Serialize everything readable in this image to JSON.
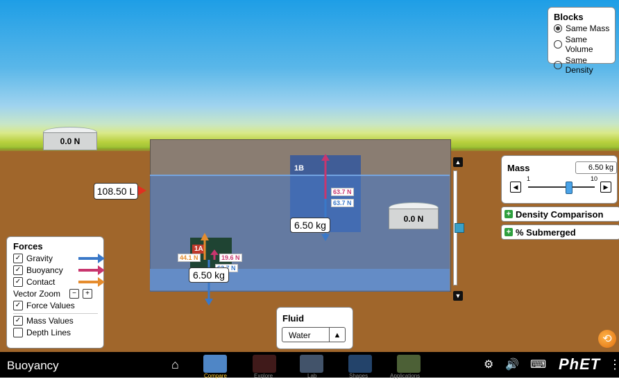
{
  "app": {
    "title": "Buoyancy"
  },
  "scene": {
    "left_scale_reading": "0.0 N",
    "right_scale_reading": "0.0 N",
    "volume_label": "108.50 L"
  },
  "blocks_panel": {
    "title": "Blocks",
    "options": [
      "Same Mass",
      "Same Volume",
      "Same Density"
    ],
    "selected": "Same Mass"
  },
  "block_b": {
    "label": "1B",
    "mass_value": "6.50 kg",
    "buoyancy_value": "63.7 N",
    "gravity_value": "63.7 N"
  },
  "block_a": {
    "label": "1A",
    "mass_value": "6.50 kg",
    "contact_value": "44.1 N",
    "buoyancy_value": "19.6 N",
    "gravity_value": "63.7 N"
  },
  "mass_panel": {
    "title": "Mass",
    "value": "6.50 kg",
    "slider_min": "1",
    "slider_max": "10",
    "slider_fraction": 0.61
  },
  "accordions": {
    "density_comparison": "Density Comparison",
    "percent_submerged": "% Submerged"
  },
  "forces_panel": {
    "title": "Forces",
    "gravity_label": "Gravity",
    "buoyancy_label": "Buoyancy",
    "contact_label": "Contact",
    "vector_zoom_label": "Vector Zoom",
    "zoom_minus": "−",
    "zoom_plus": "+",
    "force_values_label": "Force Values",
    "mass_values_label": "Mass Values",
    "depth_lines_label": "Depth Lines",
    "gravity_color": "#3a78c8",
    "buoyancy_color": "#c8366e",
    "contact_color": "#e58c2e"
  },
  "fluid_panel": {
    "title": "Fluid",
    "selected": "Water"
  },
  "navbar": {
    "tabs": [
      "Compare",
      "Explore",
      "Lab",
      "Shapes",
      "Applications"
    ],
    "active_tab": "Compare",
    "brand": "PhET"
  }
}
